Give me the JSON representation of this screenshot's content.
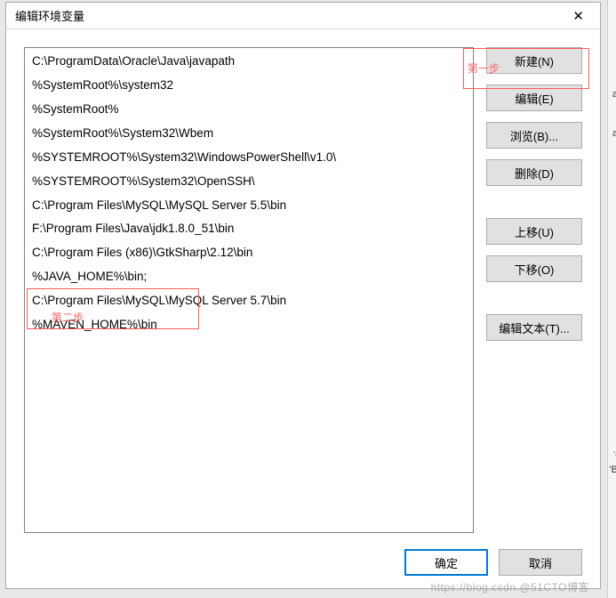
{
  "dialog": {
    "title": "编辑环境变量",
    "close_glyph": "✕"
  },
  "path_entries": [
    "C:\\ProgramData\\Oracle\\Java\\javapath",
    "%SystemRoot%\\system32",
    "%SystemRoot%",
    "%SystemRoot%\\System32\\Wbem",
    "%SYSTEMROOT%\\System32\\WindowsPowerShell\\v1.0\\",
    "%SYSTEMROOT%\\System32\\OpenSSH\\",
    "C:\\Program Files\\MySQL\\MySQL Server 5.5\\bin",
    "F:\\Program Files\\Java\\jdk1.8.0_51\\bin",
    "C:\\Program Files (x86)\\GtkSharp\\2.12\\bin",
    "%JAVA_HOME%\\bin;",
    "C:\\Program Files\\MySQL\\MySQL Server 5.7\\bin",
    "%MAVEN_HOME%\\bin"
  ],
  "buttons": {
    "new": "新建(N)",
    "edit": "编辑(E)",
    "browse": "浏览(B)...",
    "delete": "删除(D)",
    "move_up": "上移(U)",
    "move_down": "下移(O)",
    "edit_text": "编辑文本(T)...",
    "ok": "确定",
    "cancel": "取消"
  },
  "annotations": {
    "step1": "第一步",
    "step2": "第二步"
  },
  "watermark": "https://blog.csdn.@51CTO博客",
  "background_slivers": {
    "a": "a",
    "b": "'B",
    "c": ".j"
  }
}
